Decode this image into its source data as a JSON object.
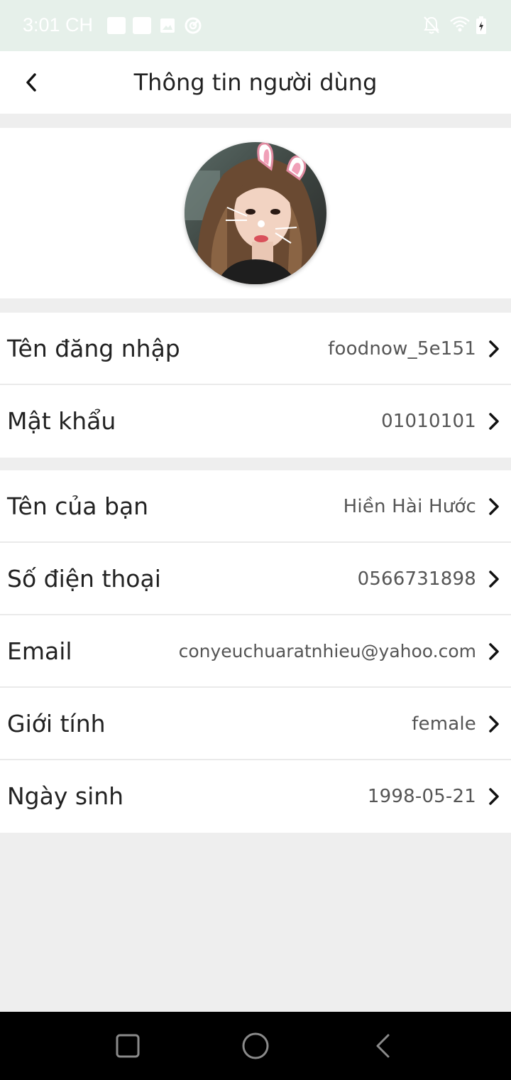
{
  "status_bar": {
    "time": "3:01 CH",
    "icons": [
      "notification-square-icon",
      "notification-square-icon",
      "image-icon",
      "data-saver-icon",
      "bell-off-icon",
      "wifi-icon",
      "battery-charging-icon"
    ]
  },
  "header": {
    "title": "Thông tin người dùng",
    "back_icon": "chevron-left-icon"
  },
  "profile": {
    "avatar": "profile-photo"
  },
  "account_group": [
    {
      "label": "Tên đăng nhập",
      "value": "foodnow_5e151"
    },
    {
      "label": "Mật khẩu",
      "value": "01010101"
    }
  ],
  "info_group": [
    {
      "label": "Tên của bạn",
      "value": "Hiền Hài Hước"
    },
    {
      "label": "Số điện thoại",
      "value": "0566731898"
    },
    {
      "label": "Email",
      "value": "conyeuchuaratnhieu@yahoo.com"
    },
    {
      "label": "Giới tính",
      "value": "female"
    },
    {
      "label": "Ngày sinh",
      "value": "1998-05-21"
    }
  ],
  "nav_bar": {
    "buttons": [
      "recents-square-icon",
      "home-circle-icon",
      "back-triangle-icon"
    ]
  },
  "colors": {
    "status_bar": "#e6f0ea",
    "background": "#eeeeee",
    "card": "#ffffff",
    "divider": "#eaeaea",
    "nav_bar": "#000000"
  }
}
